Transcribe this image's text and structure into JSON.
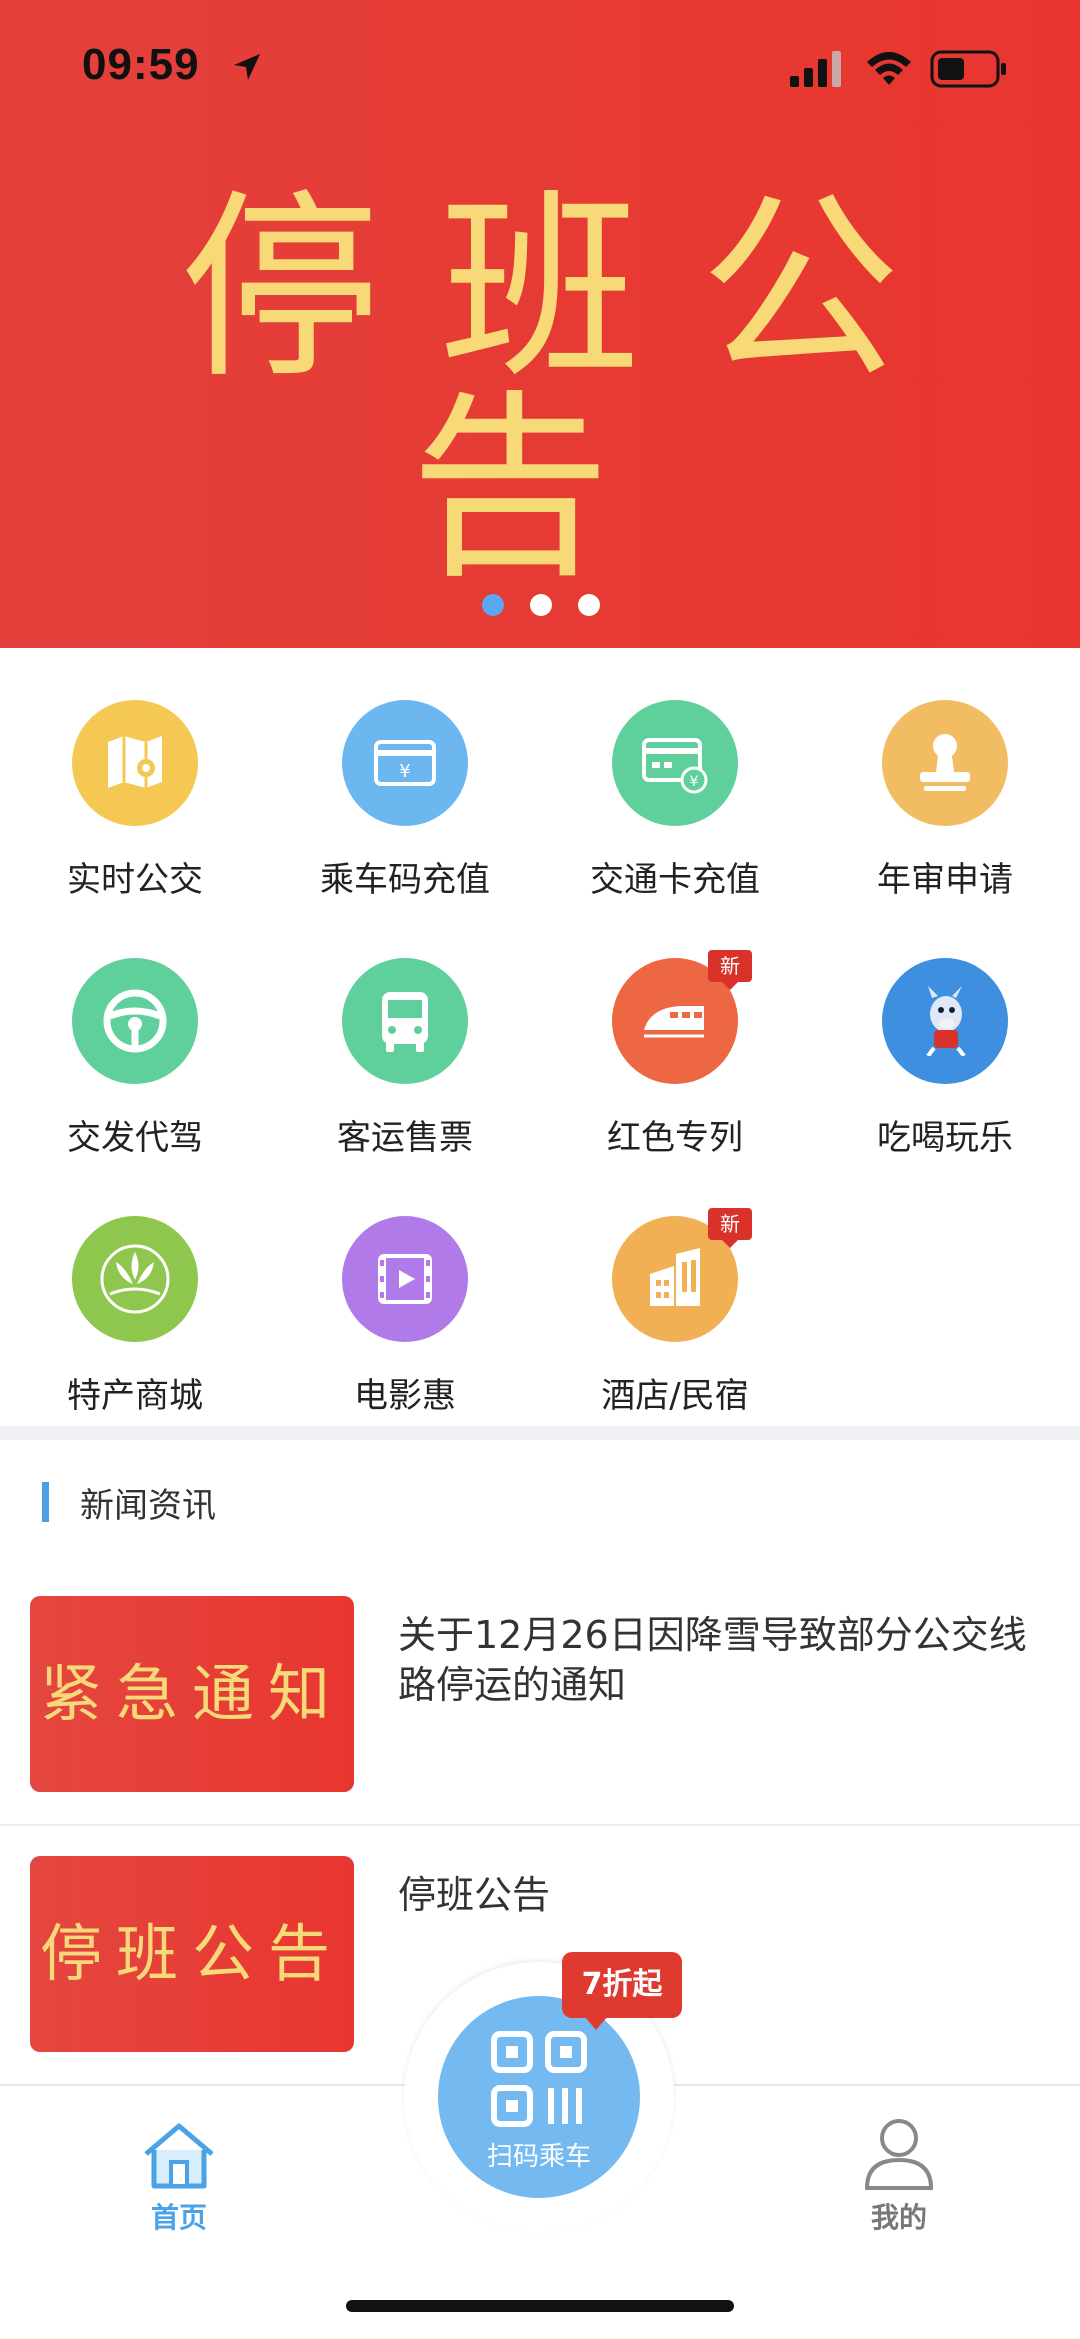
{
  "status_bar": {
    "time": "09:59"
  },
  "banner": {
    "title": "停班公告",
    "slides": 3,
    "active_slide": 1
  },
  "services": [
    {
      "label": "实时公交",
      "icon": "map-pin-icon",
      "color": "#f4c852",
      "badge": ""
    },
    {
      "label": "乘车码充值",
      "icon": "card-yuan-icon",
      "color": "#6cb7f0",
      "badge": ""
    },
    {
      "label": "交通卡充值",
      "icon": "transit-card-icon",
      "color": "#5fcf9b",
      "badge": ""
    },
    {
      "label": "年审申请",
      "icon": "stamp-icon",
      "color": "#f2bd62",
      "badge": ""
    },
    {
      "label": "交发代驾",
      "icon": "steering-wheel-icon",
      "color": "#5fcf9b",
      "badge": ""
    },
    {
      "label": "客运售票",
      "icon": "bus-icon",
      "color": "#5fcf9b",
      "badge": ""
    },
    {
      "label": "红色专列",
      "icon": "train-icon",
      "color": "#ee6743",
      "badge": "新"
    },
    {
      "label": "吃喝玩乐",
      "icon": "donkey-mascot-icon",
      "color": "#3f8fe0",
      "badge": ""
    },
    {
      "label": "特产商城",
      "icon": "specialty-logo-icon",
      "color": "#8fc64e",
      "badge": ""
    },
    {
      "label": "电影惠",
      "icon": "film-icon",
      "color": "#b07ae8",
      "badge": ""
    },
    {
      "label": "酒店/民宿",
      "icon": "hotel-building-icon",
      "color": "#f2b055",
      "badge": "新"
    }
  ],
  "news": {
    "section_title": "新闻资讯",
    "items": [
      {
        "thumb_text": "紧急通知",
        "title": "关于12月26日因降雪导致部分公交线路停运的通知"
      },
      {
        "thumb_text": "停班公告",
        "title": "停班公告"
      }
    ]
  },
  "tabbar": {
    "home_label": "首页",
    "scan_label": "扫码乘车",
    "scan_badge": "7折起",
    "mine_label": "我的"
  },
  "colors": {
    "accent": "#4aa3e6",
    "banner": "#e63a33",
    "banner_text": "#f7d977"
  }
}
